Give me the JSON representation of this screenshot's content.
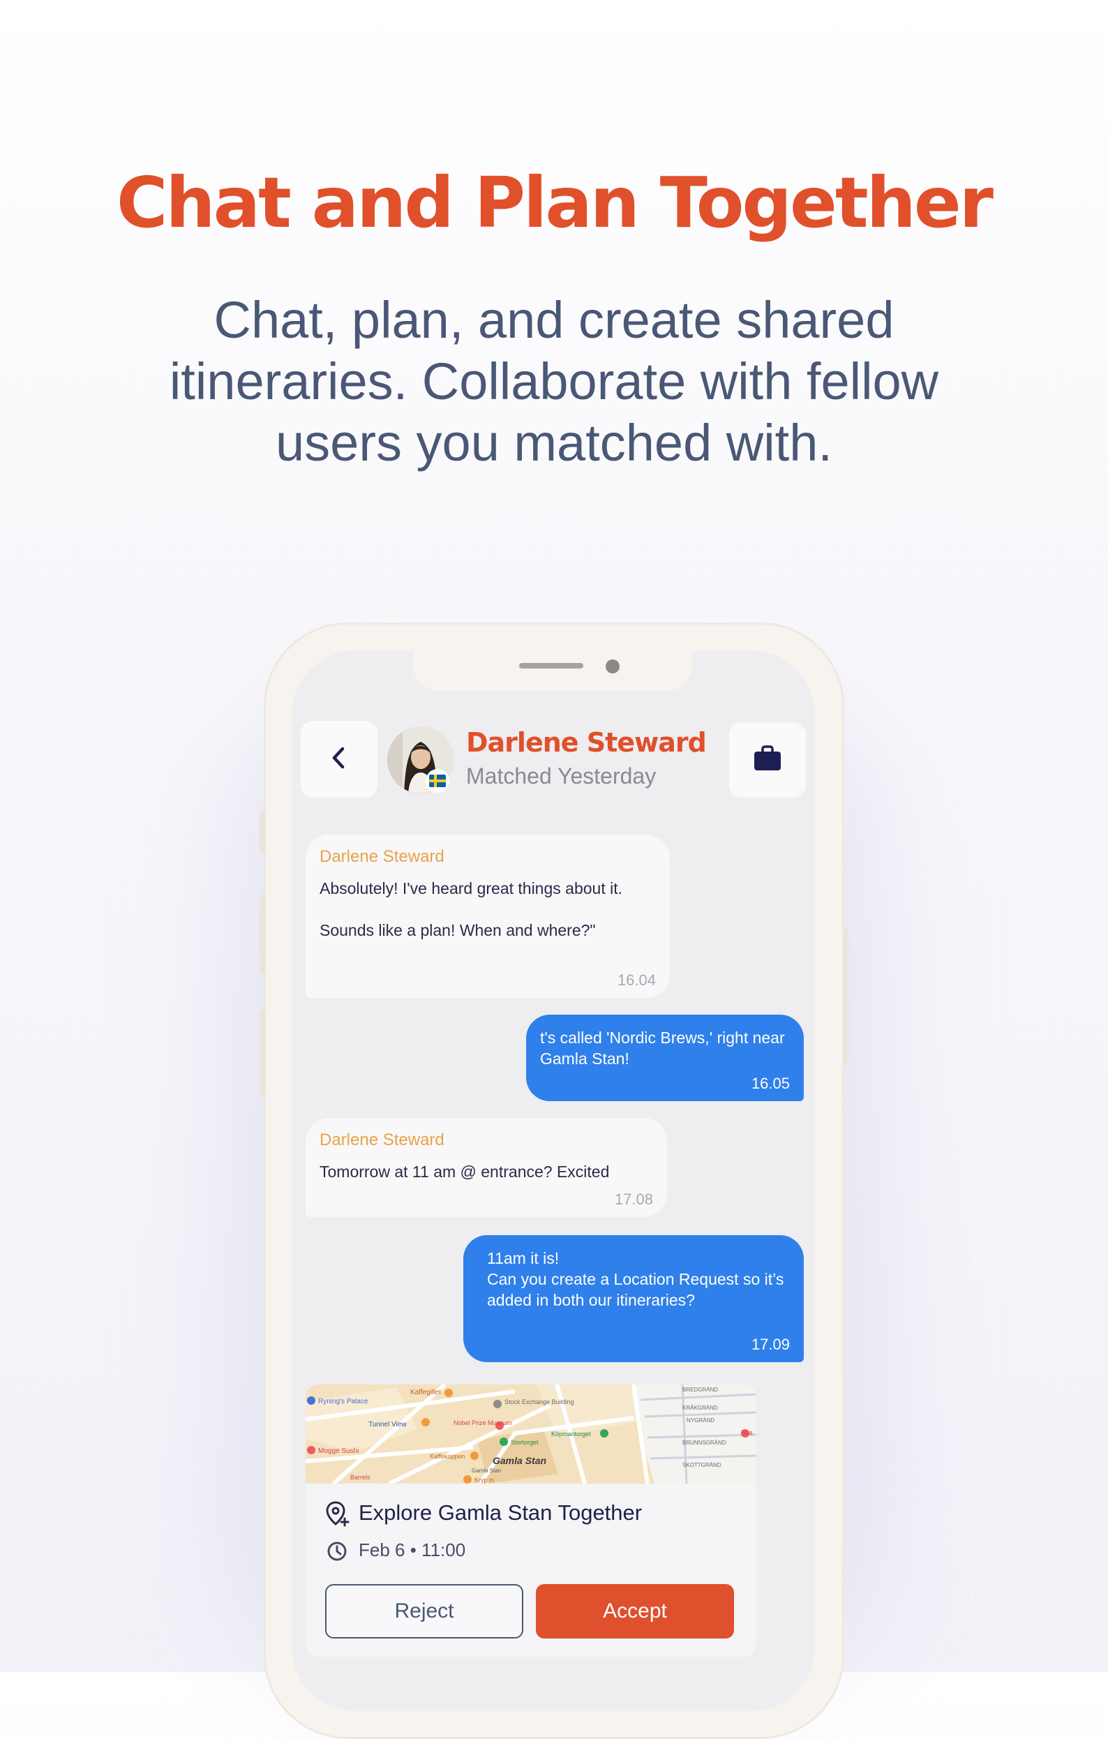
{
  "hero": {
    "title": "Chat and Plan Together",
    "subtitle": "Chat, plan, and create shared itineraries. Collaborate with fellow users you matched with."
  },
  "chat_header": {
    "back_icon": "chevron-left-icon",
    "contact_name": "Darlene Steward",
    "status": "Matched Yesterday",
    "flag_icon": "sweden-flag-icon",
    "action_icon": "briefcase-icon"
  },
  "messages": [
    {
      "direction": "in",
      "sender": "Darlene Steward",
      "text": "Absolutely! I've heard great things about it.\n\nSounds like a plan! When and where?\"",
      "time": "16.04"
    },
    {
      "direction": "out",
      "text": "t's called 'Nordic Brews,' right near Gamla Stan!",
      "time": "16.05"
    },
    {
      "direction": "in",
      "sender": "Darlene Steward",
      "text": "Tomorrow at 11 am @ entrance? Excited",
      "time": "17.08"
    },
    {
      "direction": "out",
      "text": "11am it is!\nCan you create a Location Request so it’s added in both our itineraries?",
      "time": "17.09"
    }
  ],
  "location_request": {
    "map_labels": [
      "Ryning's Palace",
      "Kaffegillet",
      "Stock Exchange Building",
      "Tunnel View",
      "Nobel Prize Museum",
      "Stortorget",
      "Köpmantorget",
      "Mogge Sushi",
      "Kaffekoppen",
      "Gamla Stan",
      "Barrels",
      "Kryp in",
      "Gamla Stan",
      "BREDGRÄND",
      "KRÅKGRÄND",
      "NYGRÄND",
      "BRUNNSGRÄND",
      "SKOTTGRÄND",
      "Rea"
    ],
    "title": "Explore Gamla Stan Together",
    "date": "Feb 6 • 11:00",
    "reject_label": "Reject",
    "accept_label": "Accept"
  },
  "colors": {
    "brand": "#e0502b",
    "outgoing_bubble": "#2f80ea",
    "sender_name": "#e8a34a",
    "body_text": "#4a5876"
  }
}
